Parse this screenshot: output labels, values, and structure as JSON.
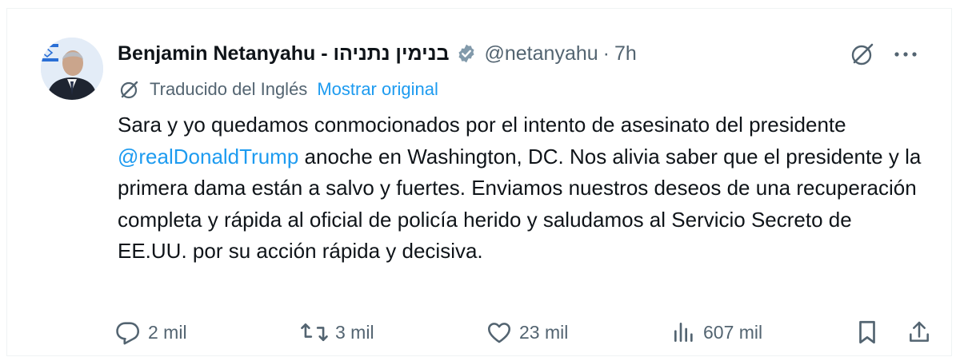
{
  "post": {
    "author_name": "Benjamin Netanyahu - בנימין נתניהו",
    "handle": "@netanyahu",
    "separator": "·",
    "time": "7h",
    "translation": {
      "label": "Traducido del Inglés",
      "show_original": "Mostrar original"
    },
    "text_before": "Sara y yo quedamos conmocionados por el intento de asesinato del presidente ",
    "mention": "@realDonaldTrump",
    "text_after": " anoche en Washington, DC. Nos alivia saber que el presidente y la primera dama están a salvo y fuertes. Enviamos nuestros deseos de una recuperación completa y rápida al oficial de policía herido y saludamos al Servicio Secreto de EE.UU. por su acción rápida y decisiva."
  },
  "actions": {
    "replies": "2 mil",
    "reposts": "3 mil",
    "likes": "23 mil",
    "views": "607 mil"
  },
  "icons": {
    "reply": "reply-icon",
    "repost": "repost-icon",
    "like": "heart-icon",
    "views": "analytics-icon",
    "bookmark": "bookmark-icon",
    "share": "share-icon",
    "grok": "grok-icon",
    "more": "more-icon",
    "translate": "translate-icon",
    "verified": "verified-badge-icon"
  },
  "colors": {
    "text": "#0f1419",
    "secondary": "#536471",
    "link": "#1d9bf0",
    "verified_badge": "#829aab"
  }
}
